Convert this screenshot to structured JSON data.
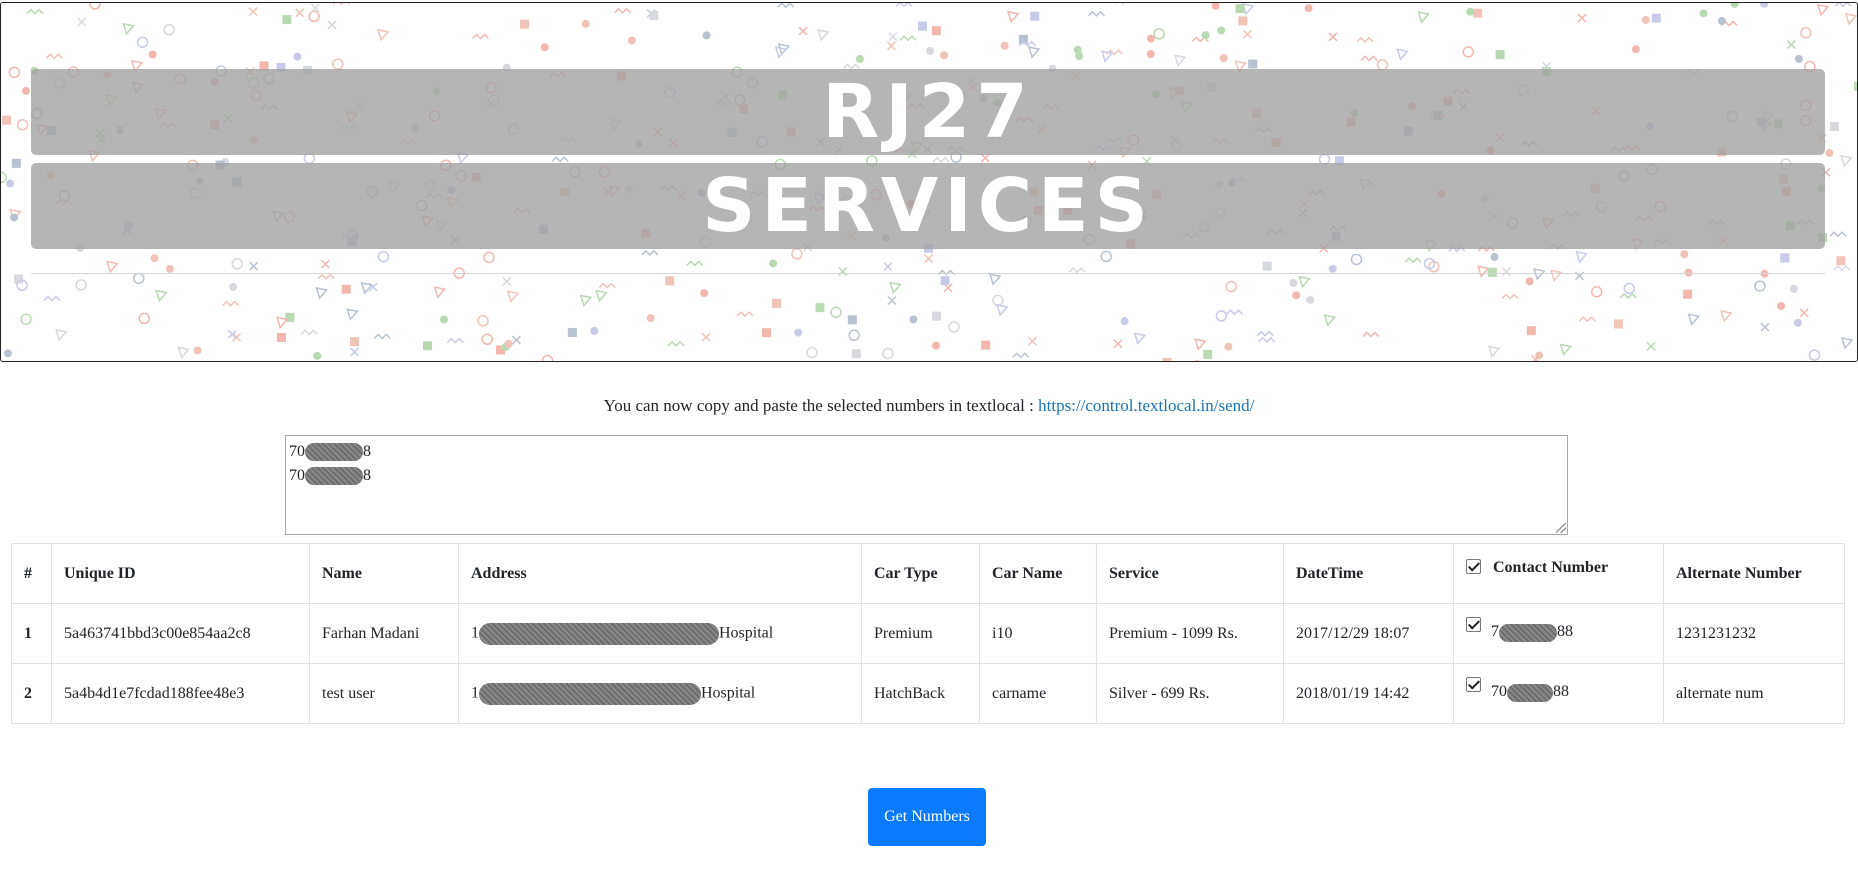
{
  "banner": {
    "line1": "RJ27",
    "line2": "SERVICES"
  },
  "info": {
    "text": "You can now copy and paste the selected numbers in textlocal : ",
    "link": "https://control.textlocal.in/send/"
  },
  "selected_numbers": [
    {
      "prefix": "70",
      "suffix": "8"
    },
    {
      "prefix": "70",
      "suffix": "8"
    }
  ],
  "table": {
    "headers": [
      "#",
      "Unique ID",
      "Name",
      "Address",
      "Car Type",
      "Car Name",
      "Service",
      "DateTime",
      "Contact Number",
      "Alternate Number"
    ],
    "select_all_checked": true,
    "rows": [
      {
        "num": "1",
        "unique_id": "5a463741bbd3c00e854aa2c8",
        "name": "Farhan Madani",
        "address_prefix": "1",
        "address_suffix": "Hospital",
        "car_type": "Premium",
        "car_name": "i10",
        "service": "Premium - 1099 Rs.",
        "datetime": "2017/12/29 18:07",
        "checked": true,
        "contact_prefix": "7",
        "contact_suffix": "88",
        "alternate": "1231231232"
      },
      {
        "num": "2",
        "unique_id": "5a4b4d1e7fcdad188fee48e3",
        "name": "test user",
        "address_prefix": "1",
        "address_suffix": "Hospital",
        "car_type": "HatchBack",
        "car_name": "carname",
        "service": "Silver - 699 Rs.",
        "datetime": "2018/01/19 14:42",
        "checked": true,
        "contact_prefix": "70",
        "contact_suffix": "88",
        "alternate": "alternate num"
      }
    ]
  },
  "button": {
    "label": "Get Numbers"
  },
  "colors": {
    "primary_button": "#0a7bff",
    "link": "#1a73b5"
  }
}
